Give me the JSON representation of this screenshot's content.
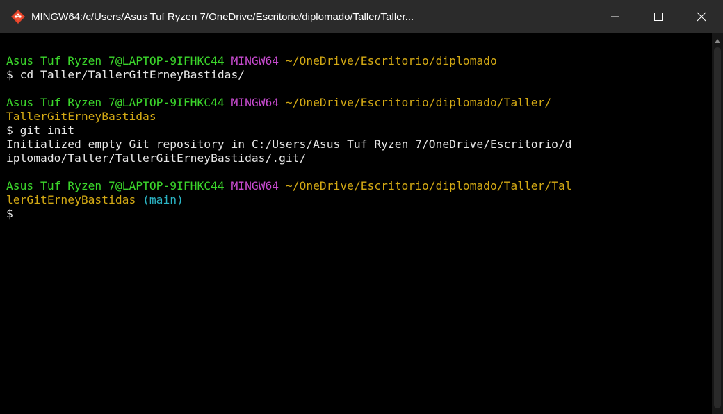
{
  "window": {
    "title": "MINGW64:/c/Users/Asus Tuf Ryzen 7/OneDrive/Escritorio/diplomado/Taller/Taller...",
    "app_icon": "git-diamond-icon",
    "controls": {
      "minimize_icon": "minimize-icon",
      "maximize_icon": "maximize-icon",
      "close_icon": "close-icon"
    }
  },
  "colors": {
    "user": "#3bd62b",
    "system": "#c84bd0",
    "path": "#d3a914",
    "branch": "#2bb6c6",
    "text": "#e6e6e6",
    "titlebar": "#2b2b2b"
  },
  "terminal": {
    "prompt1": {
      "user": "Asus Tuf Ryzen 7@LAPTOP-9IFHKC44",
      "system": "MINGW64",
      "path": "~/OneDrive/Escritorio/diplomado",
      "command_line": "$ cd Taller/TallerGitErneyBastidas/"
    },
    "prompt2": {
      "user": "Asus Tuf Ryzen 7@LAPTOP-9IFHKC44",
      "system": "MINGW64",
      "path_line1": "~/OneDrive/Escritorio/diplomado/Taller/",
      "path_line2": "TallerGitErneyBastidas",
      "command_line": "$ git init",
      "output_line1": "Initialized empty Git repository in C:/Users/Asus Tuf Ryzen 7/OneDrive/Escritorio/d",
      "output_line2": "iplomado/Taller/TallerGitErneyBastidas/.git/"
    },
    "prompt3": {
      "user": "Asus Tuf Ryzen 7@LAPTOP-9IFHKC44",
      "system": "MINGW64",
      "path_line1": "~/OneDrive/Escritorio/diplomado/Taller/Tal",
      "path_line2": "lerGitErneyBastidas",
      "branch": "(main)",
      "command_line": "$"
    }
  }
}
